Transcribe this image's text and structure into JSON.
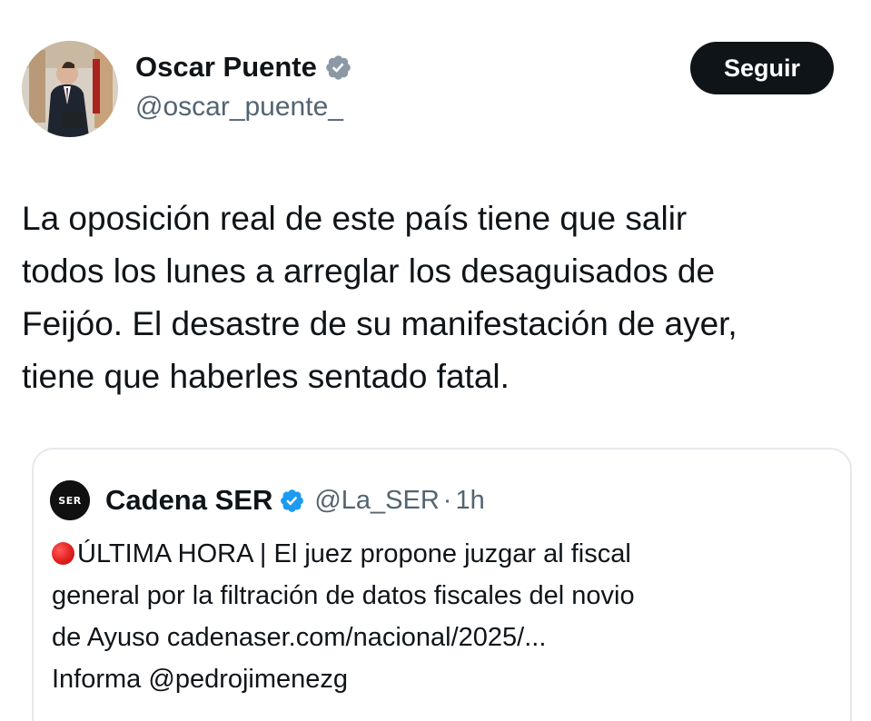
{
  "tweet": {
    "author": {
      "display_name": "Oscar Puente",
      "handle": "@oscar_puente_",
      "verified_icon": "verified-badge-icon"
    },
    "follow_button_label": "Seguir",
    "text_lines": [
      "La oposición real de este país tiene que salir",
      "todos los lunes a arreglar los desaguisados de",
      "Feijóo. El desastre de su manifestación de ayer,",
      "tiene que haberles sentado fatal."
    ]
  },
  "quoted_tweet": {
    "avatar_text": "SER",
    "display_name": "Cadena SER",
    "handle": "@La_SER",
    "separator": "·",
    "time": "1h",
    "line1_text": "ÚLTIMA HORA | El juez propone juzgar al fiscal",
    "line2_text": "general por la filtración de datos fiscales del novio",
    "line3_prefix": "de Ayuso ",
    "line3_link": "cadenaser.com/nacional/2025/...",
    "line4_prefix": "Informa ",
    "line4_link": "@pedrojimenezg",
    "alert_icon": "red-circle-icon"
  },
  "colors": {
    "text": "#0f1419",
    "secondary": "#536471",
    "verified": "#1d9bf0",
    "button_bg": "#0f1419",
    "card_border": "#e6e9ec"
  }
}
